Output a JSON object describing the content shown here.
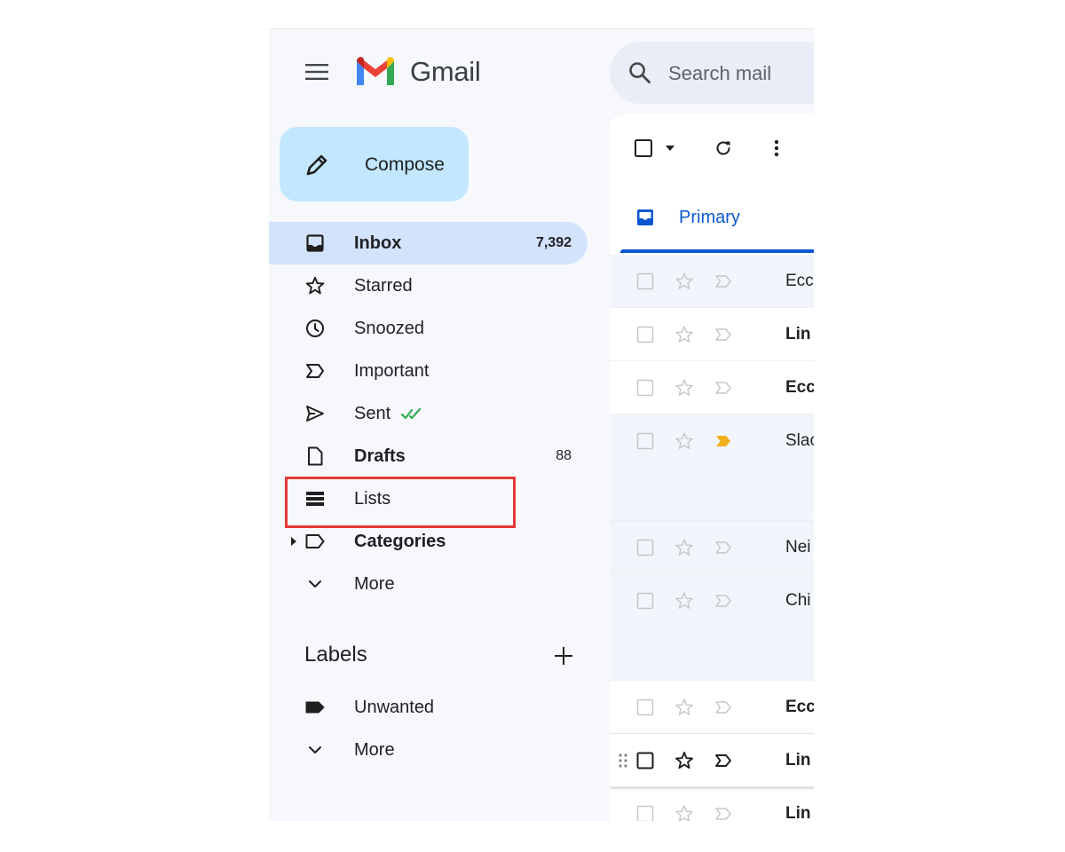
{
  "app": {
    "brand": "Gmail",
    "colors": {
      "accent": "#0b57d0",
      "compose_bg": "#c2e7ff",
      "active_nav": "#d3e3fd",
      "highlight": "#e53935",
      "sent_check": "#34a853",
      "important_marker": "#f2b01e"
    }
  },
  "search": {
    "placeholder": "Search mail"
  },
  "compose": {
    "label": "Compose"
  },
  "nav": {
    "inbox": {
      "label": "Inbox",
      "count": "7,392",
      "icon": "inbox-icon"
    },
    "starred": {
      "label": "Starred",
      "icon": "star-icon"
    },
    "snoozed": {
      "label": "Snoozed",
      "icon": "clock-icon"
    },
    "important": {
      "label": "Important",
      "icon": "important-icon"
    },
    "sent": {
      "label": "Sent",
      "icon": "send-icon"
    },
    "drafts": {
      "label": "Drafts",
      "count": "88",
      "icon": "draft-icon"
    },
    "lists": {
      "label": "Lists",
      "icon": "lists-icon"
    },
    "categories": {
      "label": "Categories",
      "icon": "label-outline-icon"
    },
    "more": {
      "label": "More",
      "icon": "chevron-down-icon"
    }
  },
  "labels": {
    "heading": "Labels",
    "items": [
      {
        "label": "Unwanted",
        "icon": "label-filled-icon"
      }
    ],
    "more": "More"
  },
  "toolbar": {
    "icons": [
      "checkbox-icon",
      "dropdown-arrow-icon",
      "refresh-icon",
      "more-vert-icon"
    ]
  },
  "tabs": {
    "primary": {
      "label": "Primary",
      "icon": "inbox-tab-icon"
    }
  },
  "emails": [
    {
      "sender": "Ecc",
      "unread": false
    },
    {
      "sender": "Lin",
      "unread": true
    },
    {
      "sender": "Ecc",
      "unread": true
    },
    {
      "sender": "Slac",
      "unread": false,
      "important": true
    },
    {
      "sender": "Nei",
      "unread": false
    },
    {
      "sender": "Chi",
      "unread": false
    },
    {
      "sender": "Ecc",
      "unread": true
    },
    {
      "sender": "Lin",
      "unread": true
    },
    {
      "sender": "Lin",
      "unread": true
    }
  ]
}
